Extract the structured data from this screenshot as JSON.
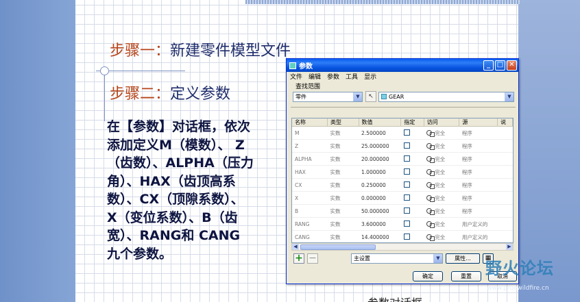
{
  "slide": {
    "step1_num": "步骤一：",
    "step1_text": "新建零件模型文件",
    "step2_num": "步骤二：",
    "step2_text": "定义参数",
    "body_lines": [
      "在【参数】对话框，依次",
      "添加定义M（模数）、 Z",
      "（齿数）、ALPHA（压力",
      "角）、HAX（齿顶高系",
      "数）、CX（顶隙系数）、",
      "X（变位系数）、B（齿",
      "宽）、RANG和 CANG",
      "九个参数。"
    ],
    "bottom_caption": "参数对话框"
  },
  "dialog": {
    "title": "参数",
    "menu": [
      "文件",
      "编辑",
      "参数",
      "工具",
      "显示"
    ],
    "scope_label": "查找范围",
    "scope_type": "零件",
    "scope_object": "GEAR",
    "columns": [
      "名称",
      "类型",
      "数值",
      "指定",
      "访问",
      "源",
      "说"
    ],
    "rows": [
      {
        "name": "M",
        "type": "实数",
        "value": "2.500000",
        "access": "完全",
        "source": "程序"
      },
      {
        "name": "Z",
        "type": "实数",
        "value": "25.000000",
        "access": "完全",
        "source": "程序"
      },
      {
        "name": "ALPHA",
        "type": "实数",
        "value": "20.000000",
        "access": "完全",
        "source": "程序"
      },
      {
        "name": "HAX",
        "type": "实数",
        "value": "1.000000",
        "access": "完全",
        "source": "程序"
      },
      {
        "name": "CX",
        "type": "实数",
        "value": "0.250000",
        "access": "完全",
        "source": "程序"
      },
      {
        "name": "X",
        "type": "实数",
        "value": "0.000000",
        "access": "完全",
        "source": "程序"
      },
      {
        "name": "B",
        "type": "实数",
        "value": "50.000000",
        "access": "完全",
        "source": "程序"
      },
      {
        "name": "RANG",
        "type": "实数",
        "value": "3.600000",
        "access": "完全",
        "source": "用户定义的"
      },
      {
        "name": "CANG",
        "type": "实数",
        "value": "14.400000",
        "access": "完全",
        "source": "用户定义的"
      }
    ],
    "set_select": "主设置",
    "properties_label": "属性...",
    "ok_label": "确定",
    "reset_label": "重置",
    "cancel_label": "取消"
  },
  "watermark": {
    "text": "野火论坛",
    "url": "www.proewildfire.cn"
  },
  "icons": {
    "add": "plus-icon",
    "remove": "minus-icon",
    "close": "close-icon",
    "access": "lock-icon"
  }
}
